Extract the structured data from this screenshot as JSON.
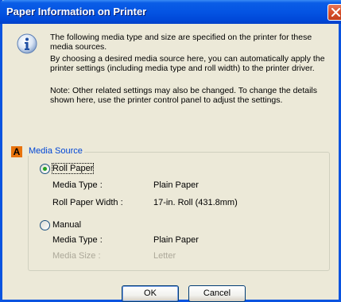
{
  "window": {
    "title": "Paper Information on Printer"
  },
  "message": {
    "line1": "The following media type and size are specified on the printer for these media sources.",
    "line2": "By choosing a desired media source here, you can automatically apply the printer settings (including media type and roll width) to the printer driver.",
    "line3": "Note: Other related settings may also be changed. To change the details shown here, use the printer control panel to adjust the settings."
  },
  "media_source": {
    "badge": "A",
    "legend": "Media Source",
    "roll_paper": {
      "label": "Roll Paper",
      "selected": true,
      "media_type_label": "Media Type :",
      "media_type_value": "Plain Paper",
      "width_label": "Roll Paper Width :",
      "width_value": "17-in. Roll (431.8mm)"
    },
    "manual": {
      "label": "Manual",
      "selected": false,
      "media_type_label": "Media Type :",
      "media_type_value": "Plain Paper",
      "media_size_label": "Media Size :",
      "media_size_value": "Letter"
    }
  },
  "buttons": {
    "ok": "OK",
    "cancel": "Cancel"
  },
  "icons": {
    "info": "info-icon",
    "close": "close-icon"
  },
  "colors": {
    "titlebar": "#0454e3",
    "legend": "#0046d5",
    "badge": "#e8730c",
    "disabled_text": "#aca899"
  }
}
